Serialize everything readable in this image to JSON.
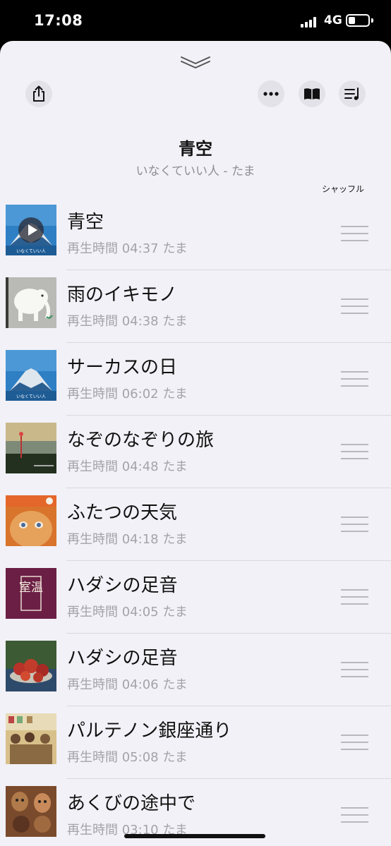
{
  "status_bar": {
    "time": "17:08",
    "network": "4G",
    "battery_level": 0.25
  },
  "icons": {
    "collapse": "double-chevron-down-icon",
    "share": "share-icon",
    "more": "ellipsis-icon",
    "lyrics": "book-icon",
    "queue": "queue-music-icon"
  },
  "now_playing": {
    "title": "青空",
    "subtitle": "いなくていい人 - たま"
  },
  "shuffle_label": "シャッフル",
  "tracks": [
    {
      "title": "青空",
      "meta": "再生時間 04:37 たま",
      "art": "mt-fuji-blue",
      "art_caption": "いなくていい人",
      "playing": true
    },
    {
      "title": "雨のイキモノ",
      "meta": "再生時間 04:38 たま",
      "art": "elephant-grey"
    },
    {
      "title": "サーカスの日",
      "meta": "再生時間 06:02 たま",
      "art": "mt-fuji-blue",
      "art_caption": "いなくていい人"
    },
    {
      "title": "なぞのなぞりの旅",
      "meta": "再生時間 04:48 たま",
      "art": "lake-landscape"
    },
    {
      "title": "ふたつの天気",
      "meta": "再生時間 04:18 たま",
      "art": "face-orange"
    },
    {
      "title": "ハダシの足音",
      "meta": "再生時間 04:05 たま",
      "art": "purple-kanji",
      "art_text": "室温"
    },
    {
      "title": "ハダシの足音",
      "meta": "再生時間 04:06 たま",
      "art": "still-life-fruit"
    },
    {
      "title": "パルテノン銀座通り",
      "meta": "再生時間 05:08 たま",
      "art": "group-photo"
    },
    {
      "title": "あくびの途中で",
      "meta": "再生時間 03:10 たま",
      "art": "brown-masks"
    }
  ],
  "colors": {
    "sheet_background": "#f2f1f7",
    "secondary_text": "#8e8e93",
    "button_background": "#e3e2e9"
  }
}
